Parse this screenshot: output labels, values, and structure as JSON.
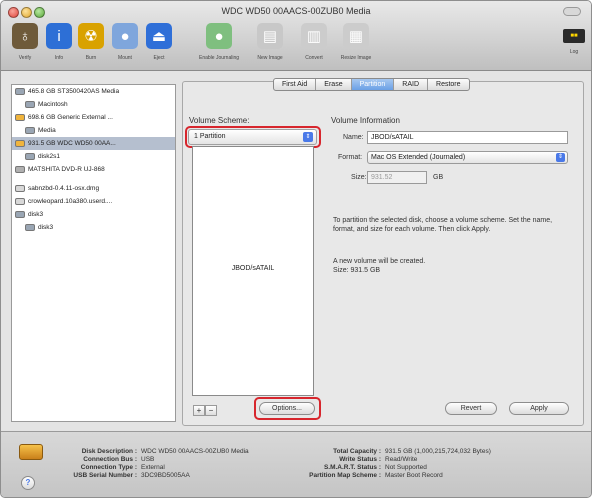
{
  "window": {
    "title": "WDC WD50 00AACS-00ZUB0 Media"
  },
  "toolbar": [
    {
      "name": "verify-button",
      "icon": "microscope-icon",
      "label": "Verify",
      "color": "#6e5a3a",
      "glyph": "♁"
    },
    {
      "name": "info-button",
      "icon": "info-icon",
      "label": "Info",
      "color": "#2d6fd6",
      "glyph": "i"
    },
    {
      "name": "burn-button",
      "icon": "burn-icon",
      "label": "Burn",
      "color": "#d9a200",
      "glyph": "☢"
    },
    {
      "name": "mount-button",
      "icon": "mount-icon",
      "label": "Mount",
      "color": "#7fa6dc",
      "glyph": "●"
    },
    {
      "name": "eject-button",
      "icon": "eject-icon",
      "label": "Eject",
      "color": "#2f6fd8",
      "glyph": "⏏"
    },
    {
      "name": "enable-journaling-button",
      "icon": "journal-icon",
      "label": "Enable Journaling",
      "color": "#7fbf7f",
      "glyph": "●"
    },
    {
      "name": "new-image-button",
      "icon": "new-image-icon",
      "label": "New Image",
      "color": "#c8c8c8",
      "glyph": "▤"
    },
    {
      "name": "convert-button",
      "icon": "convert-icon",
      "label": "Convert",
      "color": "#cccccc",
      "glyph": "▥"
    },
    {
      "name": "resize-image-button",
      "icon": "resize-image-icon",
      "label": "Resize Image",
      "color": "#cccccc",
      "glyph": "▦"
    }
  ],
  "log_button": {
    "label": "Log"
  },
  "sidebar": [
    {
      "label": "465.8 GB ST3500420AS Media",
      "indent": 0,
      "kind": "disk",
      "selected": false
    },
    {
      "label": "Macintosh",
      "indent": 1,
      "kind": "volume",
      "selected": false
    },
    {
      "label": "698.6 GB Generic External ...",
      "indent": 0,
      "kind": "ext",
      "selected": false
    },
    {
      "label": "Media",
      "indent": 1,
      "kind": "volume",
      "selected": false
    },
    {
      "label": "931.5 GB WDC WD50 00AA...",
      "indent": 0,
      "kind": "ext",
      "selected": true
    },
    {
      "label": "disk2s1",
      "indent": 1,
      "kind": "volume",
      "selected": false
    },
    {
      "label": "MATSHITA DVD-R UJ-868",
      "indent": 0,
      "kind": "dvd",
      "selected": false
    },
    {
      "label": "",
      "indent": 0,
      "kind": "gap",
      "selected": false
    },
    {
      "label": "sabnzbd-0.4.11-osx.dmg",
      "indent": 0,
      "kind": "dmg",
      "selected": false
    },
    {
      "label": "crowleopard.10a380.userd....",
      "indent": 0,
      "kind": "dmg",
      "selected": false
    },
    {
      "label": "disk3",
      "indent": 0,
      "kind": "disk",
      "selected": false
    },
    {
      "label": "disk3",
      "indent": 1,
      "kind": "volume",
      "selected": false
    }
  ],
  "tabs": [
    {
      "label": "First Aid",
      "active": false
    },
    {
      "label": "Erase",
      "active": false
    },
    {
      "label": "Partition",
      "active": true
    },
    {
      "label": "RAID",
      "active": false
    },
    {
      "label": "Restore",
      "active": false
    }
  ],
  "partition": {
    "scheme_heading": "Volume Scheme:",
    "scheme_value": "1 Partition",
    "volume_label": "JBOD/sATAIL",
    "options_label": "Options...",
    "add_label": "+",
    "remove_label": "−"
  },
  "volume_info": {
    "heading": "Volume Information",
    "name_label": "Name:",
    "name_value": "JBOD/sATAIL",
    "format_label": "Format:",
    "format_value": "Mac OS Extended (Journaled)",
    "size_label": "Size:",
    "size_value": "931.52",
    "size_unit": "GB",
    "help_text": "To partition the selected disk, choose a volume scheme. Set the name, format, and size for each volume. Then click Apply.",
    "status_line1": "A new volume will be created.",
    "status_line2": "Size: 931.5 GB"
  },
  "buttons": {
    "revert": "Revert",
    "apply": "Apply"
  },
  "footer": {
    "disk_description_label": "Disk Description :",
    "disk_description_value": "WDC WD50 00AACS-00ZUB0 Media",
    "connection_bus_label": "Connection Bus :",
    "connection_bus_value": "USB",
    "connection_type_label": "Connection Type :",
    "connection_type_value": "External",
    "usb_serial_label": "USB Serial Number :",
    "usb_serial_value": "3DC9BD5005AA",
    "total_capacity_label": "Total Capacity :",
    "total_capacity_value": "931.5 GB (1,000,215,724,032 Bytes)",
    "write_status_label": "Write Status :",
    "write_status_value": "Read/Write",
    "smart_status_label": "S.M.A.R.T. Status :",
    "smart_status_value": "Not Supported",
    "partition_map_label": "Partition Map Scheme :",
    "partition_map_value": "Master Boot Record",
    "help_glyph": "?"
  },
  "colors": {
    "accent": "#4a79e8",
    "highlight": "#d7262d",
    "selection": "#b5bfcf"
  }
}
